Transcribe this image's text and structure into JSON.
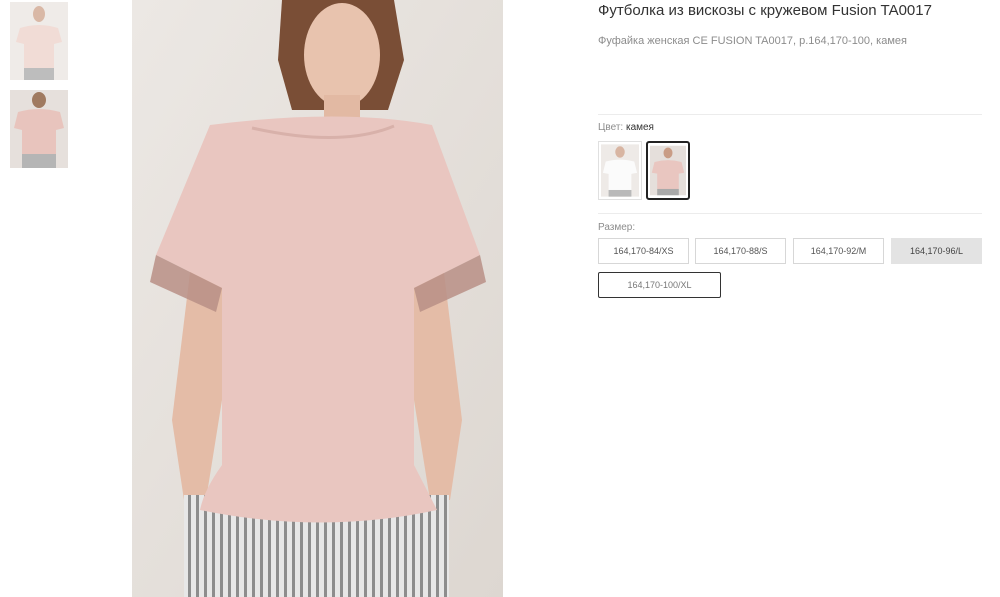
{
  "product": {
    "title": "Футболка из вискозы с кружевом Fusion TA0017",
    "subtitle": "Фуфайка женская CE FUSION TA0017, р.164,170-100, камея"
  },
  "color": {
    "label": "Цвет:",
    "selected": "камея",
    "swatches": [
      "white-tshirt-swatch",
      "cameo-tshirt-swatch"
    ]
  },
  "size": {
    "label": "Размер:",
    "options": [
      "164,170-84/XS",
      "164,170-88/S",
      "164,170-92/M",
      "164,170-96/L",
      "164,170-100/XL"
    ]
  },
  "colors": {
    "cameo": "#e9c6c0",
    "selected_size_bg": "#e3e3e3",
    "border_dark": "#333333"
  }
}
